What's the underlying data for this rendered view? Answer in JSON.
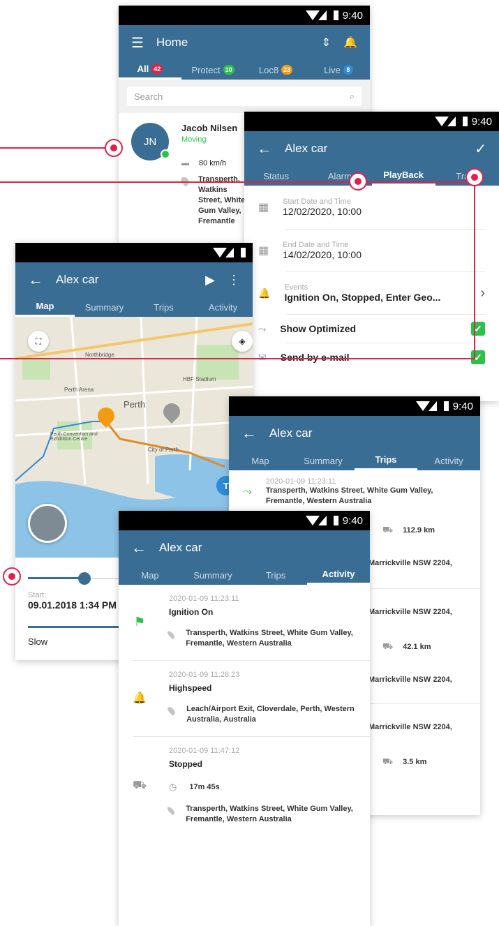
{
  "statusbar": {
    "time": "9:40"
  },
  "home": {
    "title": "Home",
    "tabs": [
      {
        "label": "All",
        "count": "42",
        "color": "#e0224b"
      },
      {
        "label": "Protect",
        "count": "10",
        "color": "#2cc14a"
      },
      {
        "label": "Loc8",
        "count": "23",
        "color": "#f39c12"
      },
      {
        "label": "Live",
        "count": "8",
        "color": "#2e8bd8"
      }
    ],
    "search_placeholder": "Search",
    "contact": {
      "initials": "JN",
      "name": "Jacob Nilsen",
      "status": "Moving",
      "speed": "80 km/h",
      "address": "Transperth, Watkins Street, White Gum Valley, Fremantle"
    }
  },
  "playback": {
    "title": "Alex car",
    "tabs": [
      "Status",
      "Alarm",
      "PlayBack",
      "Track"
    ],
    "active_tab": "PlayBack",
    "start_label": "Start Date and Time",
    "start_value": "12/02/2020, 10:00",
    "end_label": "End Date and Time",
    "end_value": "14/02/2020, 10:00",
    "events_label": "Events",
    "events_value": "Ignition On, Stopped, Enter Geo...",
    "show_optimized": "Show Optimized",
    "send_email": "Send by e-mail"
  },
  "mapscreen": {
    "title": "Alex car",
    "tabs": [
      "Map",
      "Summary",
      "Trips",
      "Activity"
    ],
    "active_tab": "Map",
    "map_labels": [
      "Perth",
      "Perth Arena",
      "Perth Convention and Exhibition Centre",
      "City of Perth",
      "HBF Stadium",
      "Northbridge"
    ],
    "start_label": "Start:",
    "start_value": "09.01.2018 1:34 PM",
    "speed_label": "Slow"
  },
  "trips": {
    "title": "Alex car",
    "tabs": [
      "Map",
      "Summary",
      "Trips",
      "Activity"
    ],
    "active_tab": "Trips",
    "first_ts": "2020-01-09 11:23:11",
    "first_addr": "Transperth, Watkins Street, White Gum Valley, Fremantle, Western Australia",
    "rows": [
      {
        "distance": "112.9 km",
        "addr": "Marrickville NSW 2204,"
      },
      {
        "addr": "Marrickville NSW 2204,"
      },
      {
        "distance": "42.1 km",
        "addr": "Marrickville NSW 2204,"
      },
      {
        "addr": "Marrickville NSW 2204,"
      },
      {
        "distance": "3.5 km"
      }
    ]
  },
  "activity": {
    "title": "Alex car",
    "tabs": [
      "Map",
      "Summary",
      "Trips",
      "Activity"
    ],
    "active_tab": "Activity",
    "items": [
      {
        "ts": "2020-01-09 11:23:11",
        "event": "Ignition On",
        "addr": "Transperth, Watkins Street, White Gum Valley, Fremantle, Western Australia",
        "icon_color": "#2cc14a"
      },
      {
        "ts": "2020-01-09 11:28:23",
        "event": "Highspeed",
        "addr": "Leach/Airport Exit, Cloverdale, Perth, Western Australia, Australia",
        "icon_color": "#f39c12"
      },
      {
        "ts": "2020-01-09 11:47:12",
        "event": "Stopped",
        "duration": "17m 45s",
        "addr": "Transperth, Watkins Street, White Gum Valley, Fremantle, Western Australia",
        "icon_color": "#bbbbbb"
      }
    ]
  }
}
